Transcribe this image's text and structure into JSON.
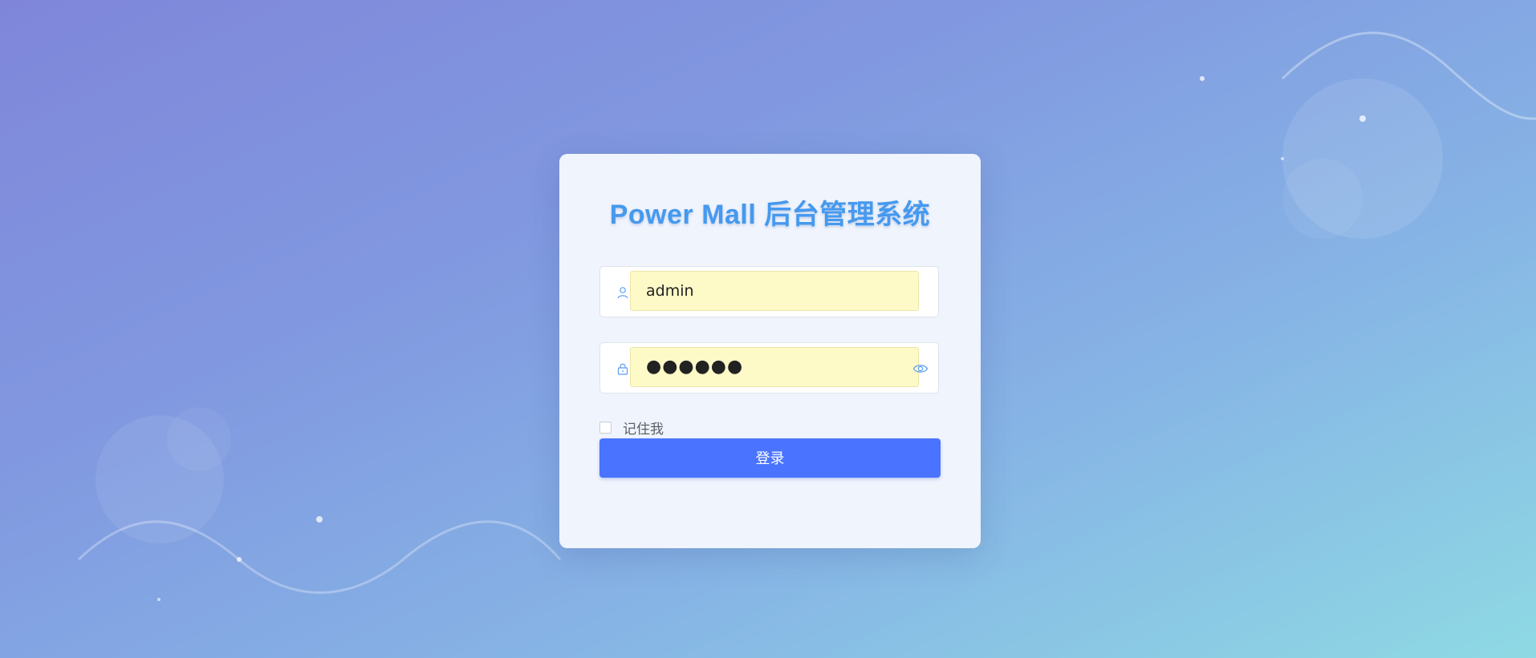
{
  "login": {
    "title": "Power Mall 后台管理系统",
    "username": {
      "icon": "user-icon",
      "value": "admin"
    },
    "password": {
      "icon": "lock-icon",
      "value": "●●●●●●",
      "toggle_icon": "eye-icon"
    },
    "remember_label": "记住我",
    "remember_checked": false,
    "submit_label": "登录"
  },
  "colors": {
    "title": "#4599ef",
    "button": "#4a74ff",
    "input_autofill": "#fefac8",
    "card": "#f0f4fc"
  }
}
